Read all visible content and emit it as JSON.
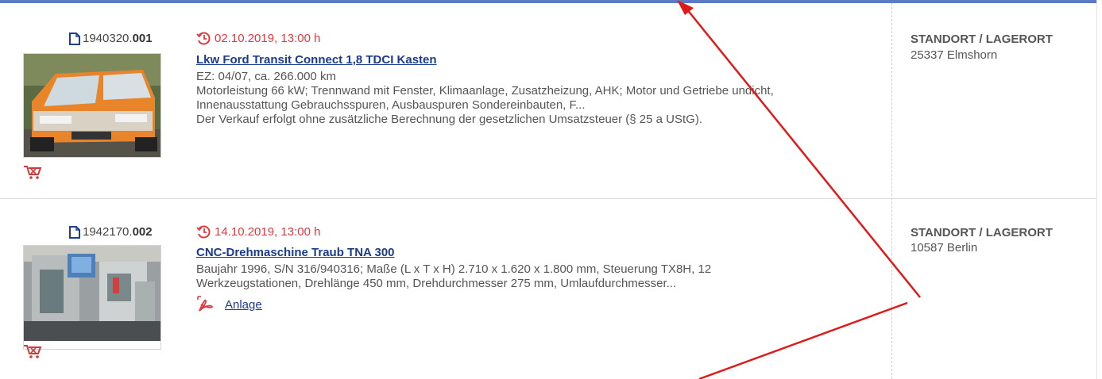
{
  "colors": {
    "accent_bar": "#5b7bc4",
    "date_red": "#e0393e",
    "link_blue": "#1a3c8c",
    "annotation_red": "#e01a1a"
  },
  "items": [
    {
      "lot_base": "1940320.",
      "lot_suffix": "001",
      "date": "02.10.2019, 13:00 h",
      "title": "Lkw Ford Transit Connect 1,8 TDCI Kasten",
      "desc_lines": [
        "EZ: 04/07, ca. 266.000 km",
        "Motorleistung 66 kW; Trennwand mit Fenster, Klimaanlage, Zusatzheizung, AHK; Motor und Getriebe undicht,",
        "Innenausstattung Gebrauchsspuren, Ausbauspuren Sondereinbauten, F...",
        "Der Verkauf erfolgt ohne zusätzliche Berechnung der gesetzlichen Umsatzsteuer (§ 25 a UStG)."
      ],
      "location_heading": "STANDORT / LAGERORT",
      "location": "25337 Elmshorn",
      "image": "orange-van-photo",
      "icons": [
        "document-icon",
        "clock-history-icon",
        "cart-icon"
      ]
    },
    {
      "lot_base": "1942170.",
      "lot_suffix": "002",
      "date": "14.10.2019, 13:00 h",
      "title": "CNC-Drehmaschine Traub TNA 300",
      "desc_lines": [
        "Baujahr 1996, S/N 316/940316; Maße (L x T x H) 2.710 x 1.620 x 1.800 mm, Steuerung TX8H, 12",
        "Werkzeugstationen, Drehlänge 450 mm, Drehdurchmesser 275 mm, Umlaufdurchmesser..."
      ],
      "attachment_label": "Anlage",
      "location_heading": "STANDORT / LAGERORT",
      "location": "10587 Berlin",
      "image": "cnc-lathe-photo",
      "icons": [
        "document-icon",
        "clock-history-icon",
        "pdf-icon",
        "cart-icon"
      ]
    }
  ]
}
